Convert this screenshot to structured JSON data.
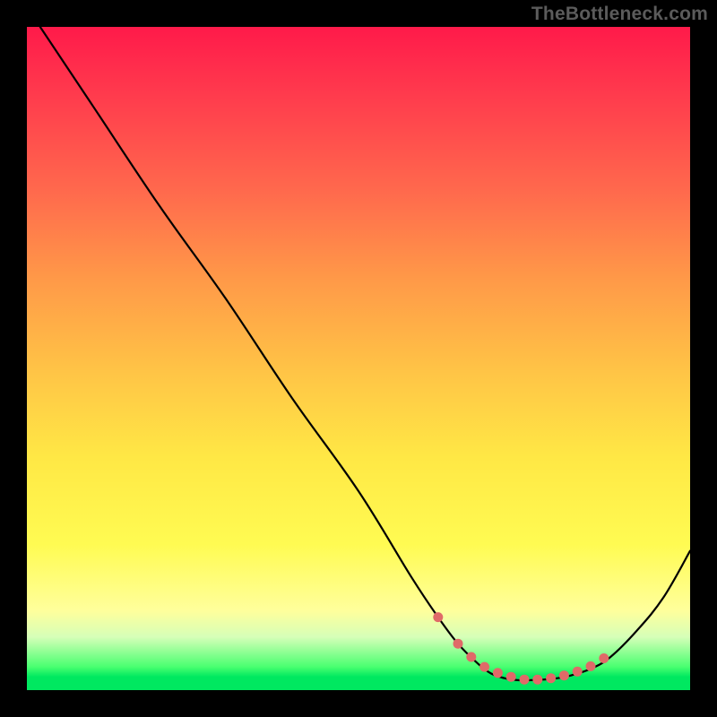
{
  "watermark": "TheBottleneck.com",
  "chart_data": {
    "type": "line",
    "title": "",
    "xlabel": "",
    "ylabel": "",
    "xlim": [
      0,
      100
    ],
    "ylim": [
      0,
      100
    ],
    "series": [
      {
        "name": "bottleneck-curve",
        "x": [
          2,
          10,
          20,
          30,
          40,
          50,
          58,
          62,
          65,
          68,
          70,
          72,
          74,
          76,
          78,
          80,
          82,
          85,
          88,
          92,
          96,
          100
        ],
        "values": [
          100,
          88,
          73,
          59,
          44,
          30,
          17,
          11,
          7,
          4,
          2.5,
          1.8,
          1.5,
          1.5,
          1.6,
          1.8,
          2.2,
          3.2,
          5,
          9,
          14,
          21
        ]
      }
    ],
    "markers": {
      "name": "highlight-dots",
      "color": "#e06a68",
      "x": [
        62,
        65,
        67,
        69,
        71,
        73,
        75,
        77,
        79,
        81,
        83,
        85,
        87
      ],
      "values": [
        11,
        7,
        5,
        3.5,
        2.6,
        2,
        1.6,
        1.6,
        1.8,
        2.2,
        2.8,
        3.6,
        4.8
      ]
    },
    "background_gradient": {
      "top": "#ff1a4a",
      "mid": "#ffe845",
      "bottom": "#00e860"
    }
  }
}
